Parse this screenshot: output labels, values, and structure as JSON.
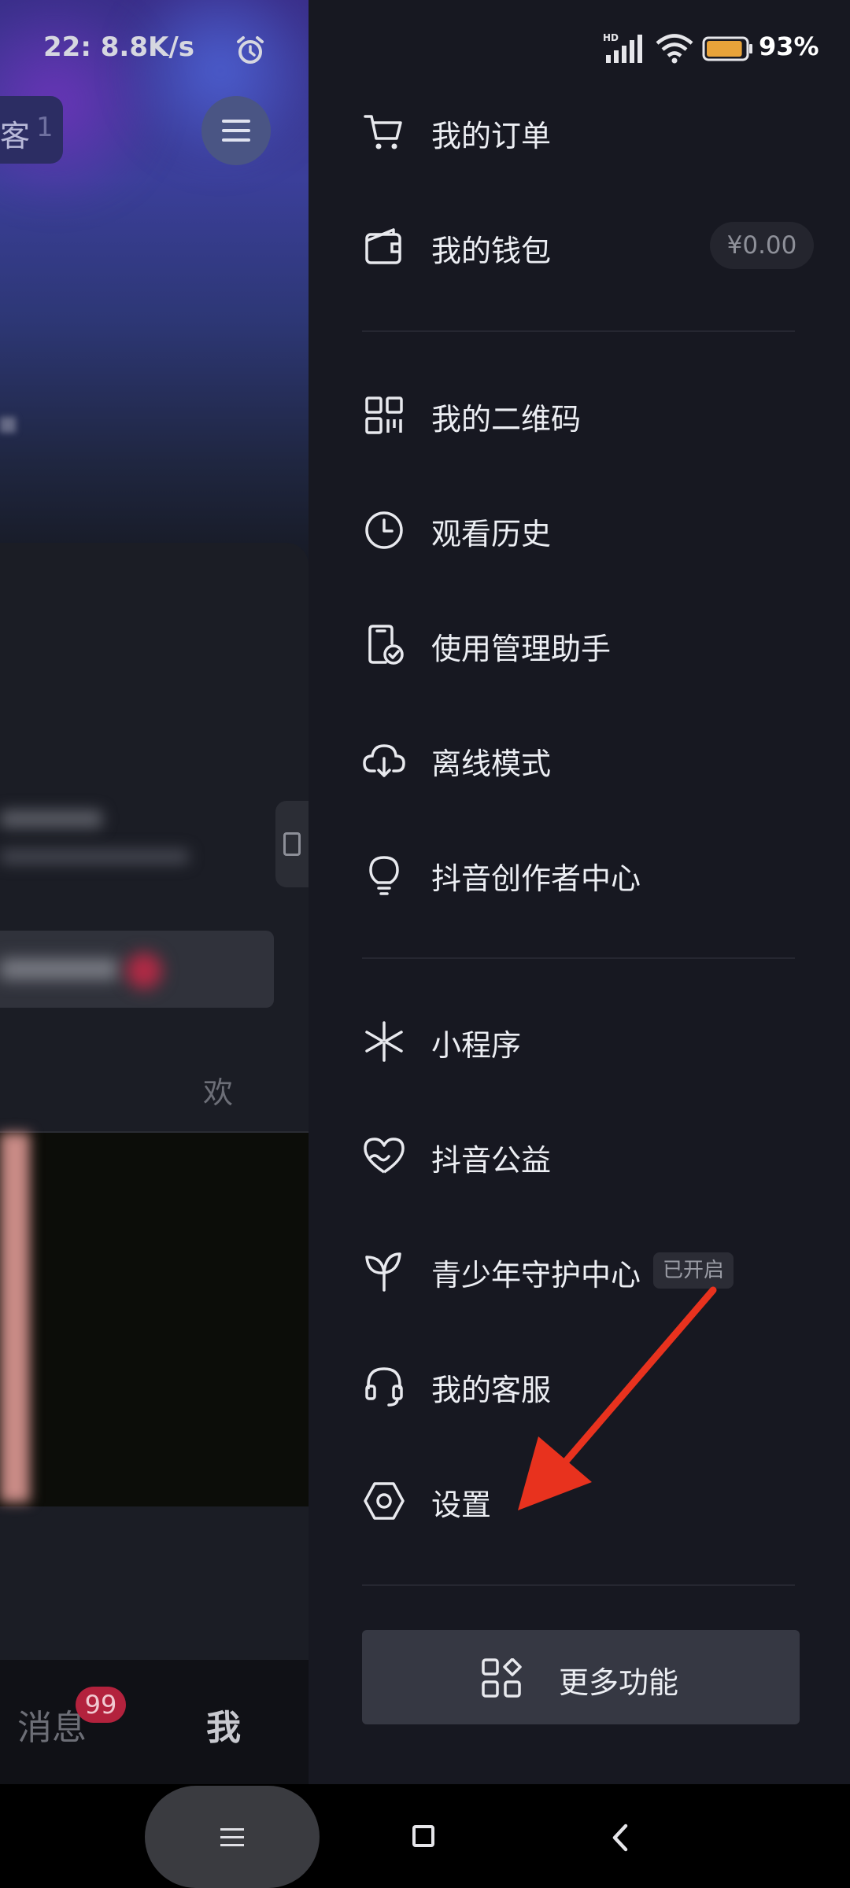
{
  "status_bar": {
    "left_text": "22:  8.8K/s",
    "battery_percent": "93%",
    "battery_level": 0.93,
    "network": "HD"
  },
  "background_screen": {
    "guest_label": "客",
    "guest_number": "1",
    "tab_like_label": "欢",
    "nav": {
      "messages_label": "消息",
      "messages_badge": "99",
      "me_label": "我"
    }
  },
  "drawer": {
    "menu_items": [
      {
        "label": "我的订单",
        "icon": "cart-icon"
      },
      {
        "label": "我的钱包",
        "icon": "wallet-icon",
        "value": "¥0.00"
      },
      {
        "label": "我的二维码",
        "icon": "qr-code-icon"
      },
      {
        "label": "观看历史",
        "icon": "clock-icon"
      },
      {
        "label": "使用管理助手",
        "icon": "phone-check-icon"
      },
      {
        "label": "离线模式",
        "icon": "cloud-download-icon"
      },
      {
        "label": "抖音创作者中心",
        "icon": "lightbulb-icon"
      },
      {
        "label": "小程序",
        "icon": "mini-program-icon"
      },
      {
        "label": "抖音公益",
        "icon": "heart-hand-icon"
      },
      {
        "label": "青少年守护中心",
        "icon": "sprout-icon",
        "tag": "已开启"
      },
      {
        "label": "我的客服",
        "icon": "headset-icon"
      },
      {
        "label": "设置",
        "icon": "hexagon-settings-icon"
      }
    ],
    "more_button_label": "更多功能"
  },
  "colors": {
    "drawer_bg": "#171821",
    "annotation_arrow": "#e8321e",
    "badge": "#b3223d"
  }
}
